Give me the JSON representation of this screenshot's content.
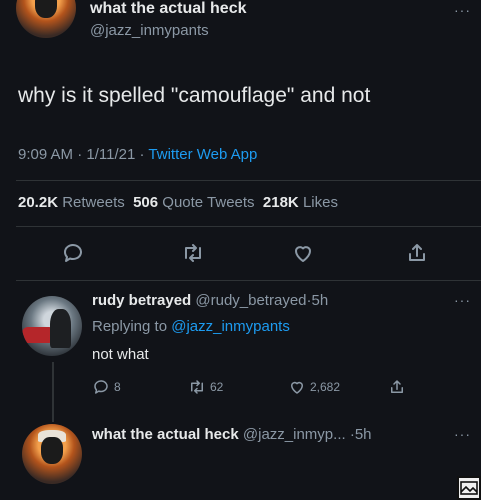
{
  "colors": {
    "background": "#111318",
    "accent": "#1d9bf0",
    "muted": "#8b98a5",
    "text": "#e7e9ea"
  },
  "main_tweet": {
    "author_name": "what the actual heck",
    "author_handle": "@jazz_inmypants",
    "more": "···",
    "text": "why is it spelled \"camouflage\" and not",
    "time": "9:09 AM",
    "date": "1/11/21",
    "separator": "·",
    "app": "Twitter Web App",
    "stats": {
      "retweets_count": "20.2K",
      "retweets_label": "Retweets",
      "quotes_count": "506",
      "quotes_label": "Quote Tweets",
      "likes_count": "218K",
      "likes_label": "Likes"
    },
    "actions": [
      "reply-icon",
      "retweet-icon",
      "like-icon",
      "share-icon"
    ]
  },
  "reply": {
    "author_name": "rudy betrayed",
    "author_handle": "@rudy_betrayed",
    "time": "5h",
    "separator": "·",
    "more": "···",
    "replying_prefix": "Replying to",
    "replying_to": "@jazz_inmypants",
    "text": "not what",
    "counts": {
      "replies": "8",
      "retweets": "62",
      "likes": "2,682"
    }
  },
  "next_tweet": {
    "author_name": "what the actual heck",
    "author_handle": "@jazz_inmyp...",
    "separator": "·",
    "time": "5h",
    "more": "···"
  }
}
